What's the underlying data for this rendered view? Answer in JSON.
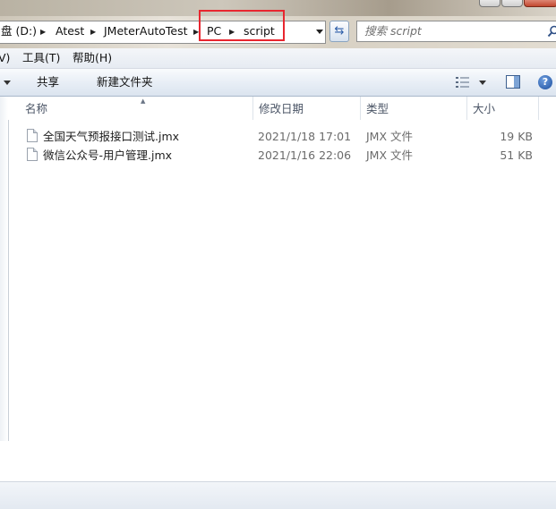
{
  "address": {
    "crumbs": [
      "盘 (D:)",
      "Atest",
      "JMeterAutoTest",
      "PC",
      "script"
    ]
  },
  "search": {
    "placeholder": "搜索 script"
  },
  "menu": {
    "items": [
      "V)",
      "工具(T)",
      "帮助(H)"
    ]
  },
  "toolbar": {
    "share_label": "共享",
    "new_folder_label": "新建文件夹"
  },
  "columns": {
    "name": "名称",
    "date": "修改日期",
    "type": "类型",
    "size": "大小"
  },
  "files": [
    {
      "name": "全国天气预报接口测试.jmx",
      "date": "2021/1/18 17:01",
      "type": "JMX 文件",
      "size": "19 KB"
    },
    {
      "name": "微信公众号-用户管理.jmx",
      "date": "2021/1/16 22:06",
      "type": "JMX 文件",
      "size": "51 KB"
    }
  ],
  "icons": {
    "refresh": "refresh-icon",
    "search": "search-icon",
    "views": "view-options-icon",
    "preview_pane": "preview-pane-icon",
    "help": "help-icon",
    "file": "file-icon"
  },
  "colors": {
    "highlight": "#e8262f",
    "command_bar": "#dbe4ef"
  }
}
